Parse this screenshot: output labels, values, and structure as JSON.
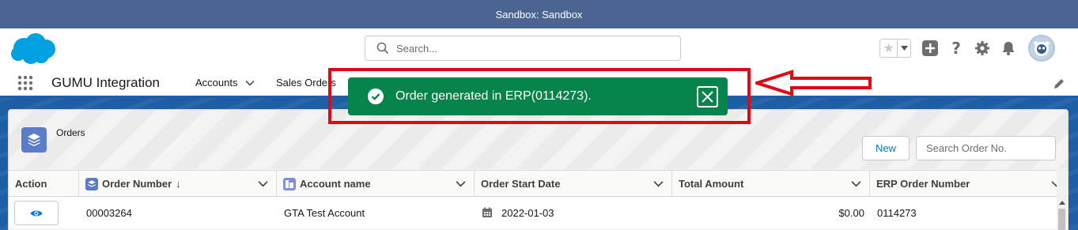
{
  "sandbox_bar": {
    "text": "Sandbox: Sandbox"
  },
  "global_header": {
    "search_placeholder": "Search...",
    "icons": [
      "salesforce-cloud-icon",
      "search-icon",
      "star-icon",
      "chevron-down-icon",
      "plus-icon",
      "help-icon",
      "gear-icon",
      "bell-icon",
      "avatar"
    ]
  },
  "nav": {
    "app_name": "GUMU Integration",
    "items": [
      {
        "label": "Accounts"
      },
      {
        "label": "Sales Orders"
      }
    ]
  },
  "toast": {
    "message": "Order generated in ERP(0114273).",
    "color": "#04844b",
    "highlight_color": "#e30613"
  },
  "card": {
    "title": "Orders",
    "new_label": "New",
    "search_placeholder": "Search Order No."
  },
  "table": {
    "columns": [
      {
        "label": "Action"
      },
      {
        "label": "Order Number",
        "sort": "↓"
      },
      {
        "label": "Account name"
      },
      {
        "label": "Order Start Date"
      },
      {
        "label": "Total Amount"
      },
      {
        "label": "ERP Order Number"
      }
    ],
    "rows": [
      {
        "order_number": "00003264",
        "account_name": "GTA Test Account",
        "order_start_date": "2022-01-03",
        "total_amount": "$0.00",
        "erp_order_number": "0114273"
      }
    ]
  },
  "colors": {
    "sandbox_bar": "#4a6592",
    "brand_blue": "#1d5fa5",
    "link_blue": "#0176d3"
  }
}
